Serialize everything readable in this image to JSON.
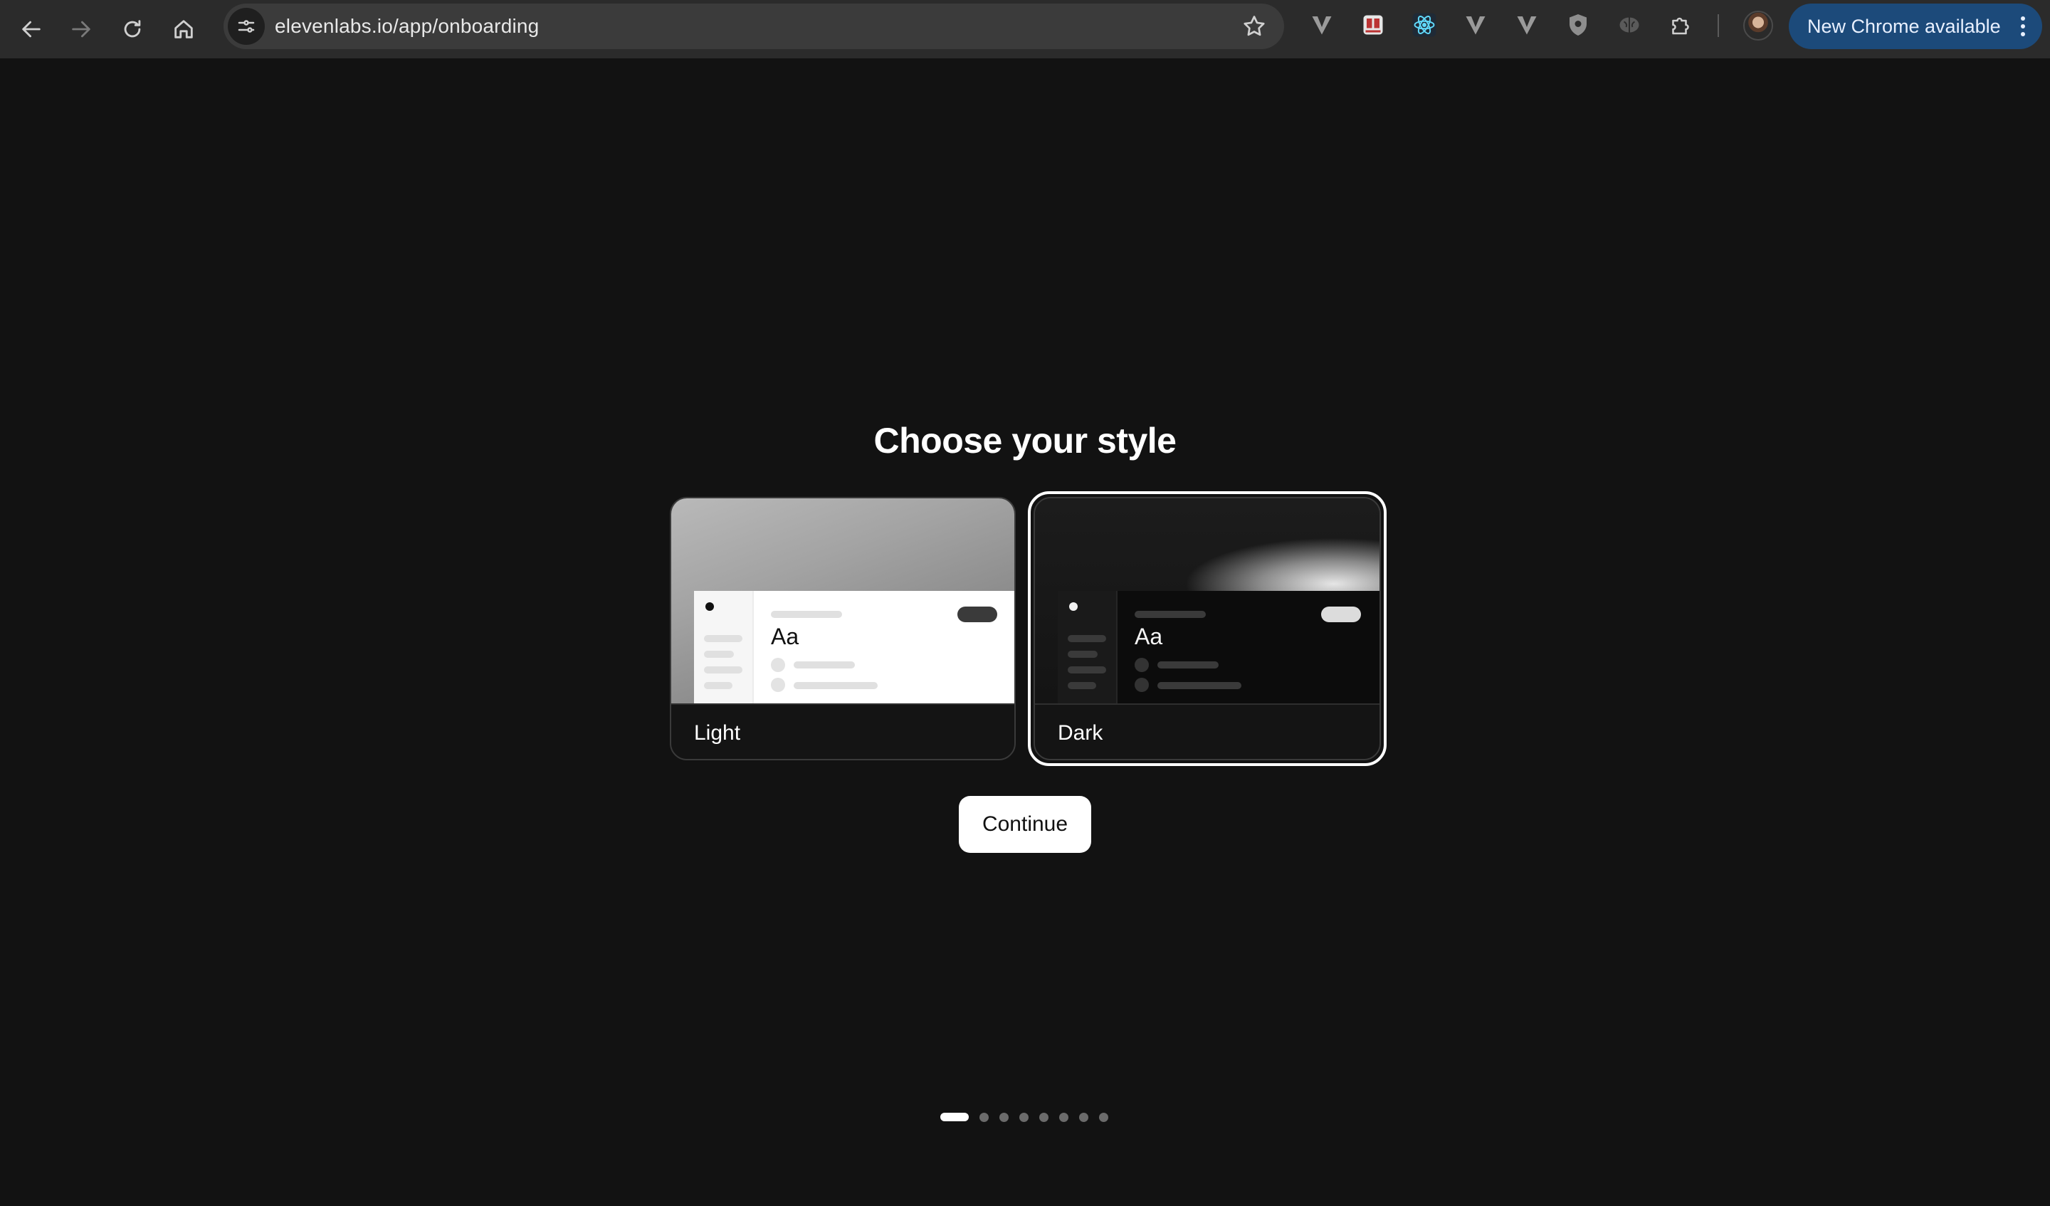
{
  "browser": {
    "url": "elevenlabs.io/app/onboarding",
    "update_label": "New Chrome available",
    "extensions": [
      "v-icon",
      "login-badge-icon",
      "react-atom-icon",
      "v-icon",
      "v-icon",
      "shield-icon",
      "brain-icon",
      "puzzle-icon"
    ]
  },
  "onboarding": {
    "title": "Choose your style",
    "options": [
      {
        "label": "Light",
        "preview_text": "Aa",
        "selected": false
      },
      {
        "label": "Dark",
        "preview_text": "Aa",
        "selected": true
      }
    ],
    "continue_label": "Continue",
    "step": 1,
    "total_steps": 8
  },
  "colors": {
    "page_bg": "#121212",
    "chrome_bg": "#2b2b2b",
    "update_bg": "#1c4a7a",
    "accent_white": "#ffffff"
  }
}
